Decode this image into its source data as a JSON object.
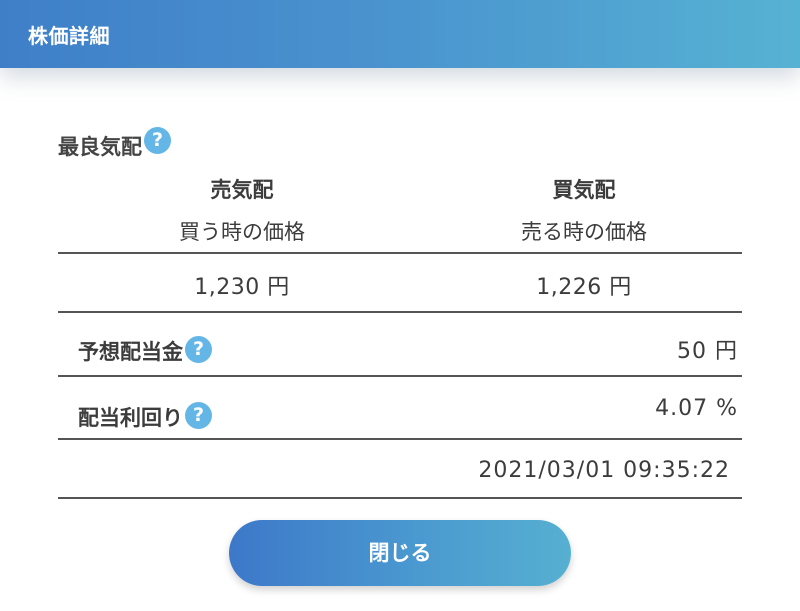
{
  "header": {
    "title": "株価詳細"
  },
  "best_quote": {
    "title": "最良気配",
    "help_icon": "question-circle-icon",
    "sell": {
      "label": "売気配",
      "sub": "買う時の価格",
      "price": "1,230 円"
    },
    "buy": {
      "label": "買気配",
      "sub": "売る時の価格",
      "price": "1,226 円"
    }
  },
  "dividend": {
    "label": "予想配当金",
    "value": "50 円"
  },
  "yield": {
    "label": "配当利回り",
    "value": "4.07 %"
  },
  "timestamp": "2021/03/01 09:35:22",
  "close_button": {
    "label": "閉じる"
  },
  "colors": {
    "header_gradient_start": "#3f7fc8",
    "header_gradient_end": "#56b2d3",
    "help_icon": "#64b6e6"
  }
}
